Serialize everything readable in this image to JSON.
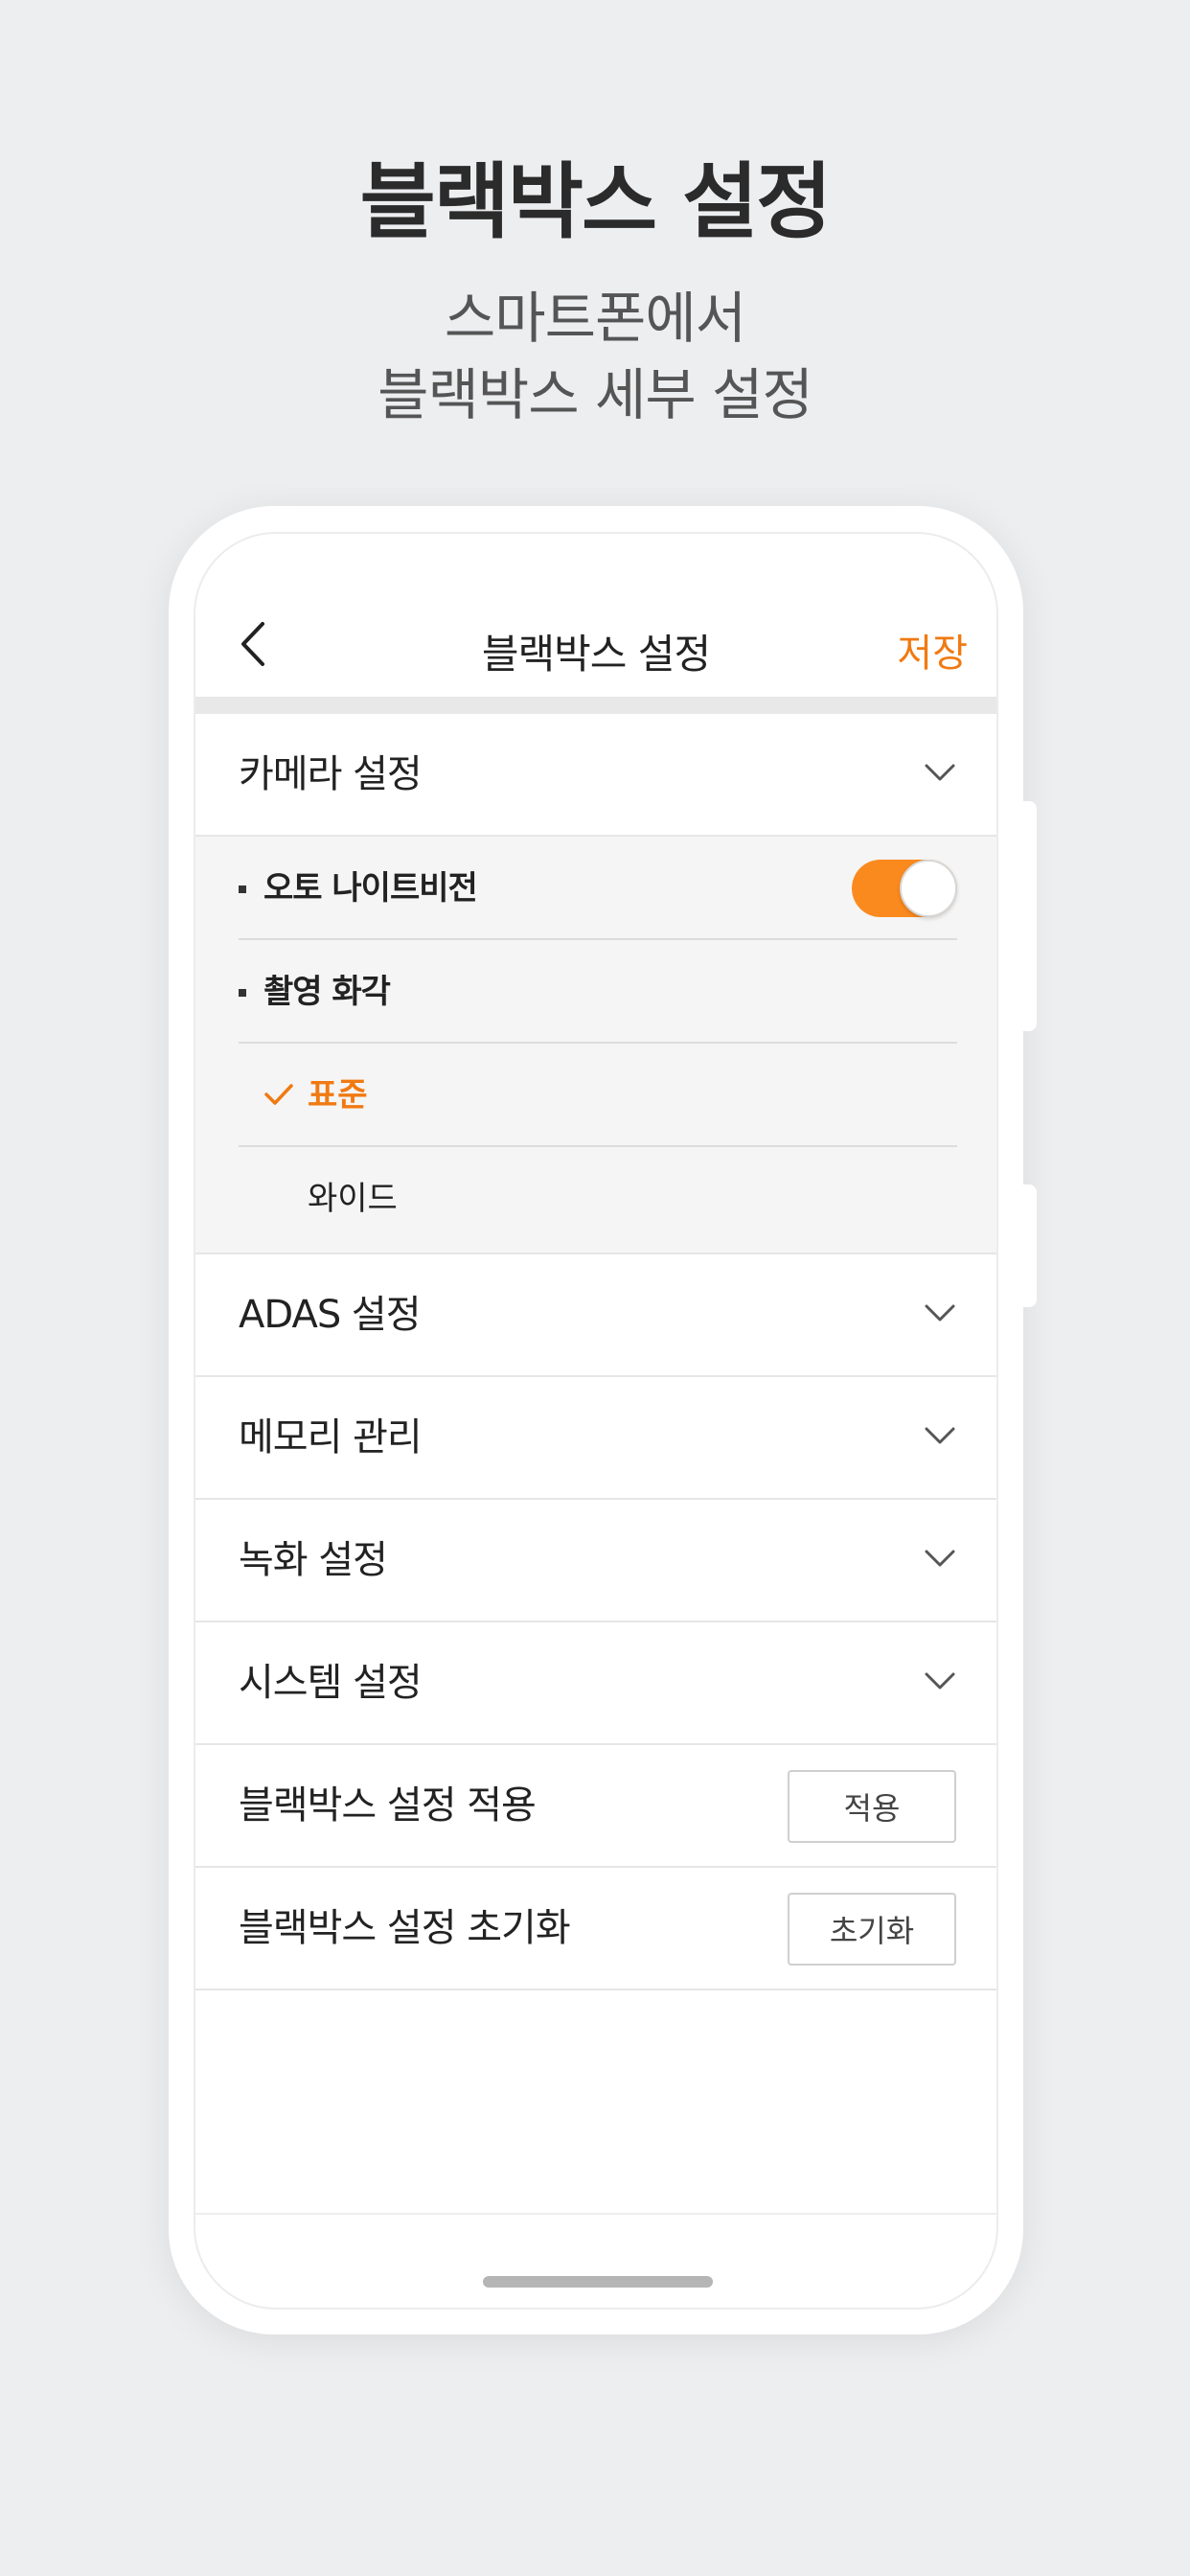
{
  "promo": {
    "title": "블랙박스 설정",
    "subtitle_line1": "스마트폰에서",
    "subtitle_line2": "블랙박스 세부 설정"
  },
  "nav": {
    "back_icon": "chevron-left-icon",
    "title": "블랙박스 설정",
    "save_label": "저장"
  },
  "sections": [
    {
      "label": "카메라 설정",
      "expanded": true
    },
    {
      "label": "ADAS 설정",
      "expanded": false
    },
    {
      "label": "메모리 관리",
      "expanded": false
    },
    {
      "label": "녹화 설정",
      "expanded": false
    },
    {
      "label": "시스템 설정",
      "expanded": false
    }
  ],
  "camera": {
    "night_vision_label": "오토 나이트비전",
    "night_vision_on": true,
    "angle_label": "촬영 화각",
    "options": [
      {
        "label": "표준",
        "selected": true
      },
      {
        "label": "와이드",
        "selected": false
      }
    ]
  },
  "actions": {
    "apply_label": "블랙박스 설정 적용",
    "apply_button": "적용",
    "reset_label": "블랙박스 설정 초기화",
    "reset_button": "초기화"
  },
  "colors": {
    "accent": "#f07a12",
    "toggle_on": "#fb8a1e",
    "background": "#edeef0"
  }
}
